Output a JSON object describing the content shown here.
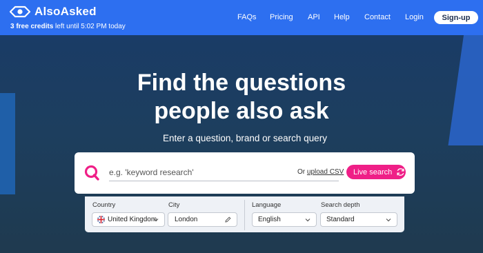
{
  "header": {
    "logo_text": "AlsoAsked",
    "credits_strong": "3 free credits",
    "credits_rest": " left until 5:02 PM today",
    "nav": [
      "FAQs",
      "Pricing",
      "API",
      "Help",
      "Contact",
      "Login"
    ],
    "signup_label": "Sign-up"
  },
  "hero": {
    "headline_line1": "Find the questions",
    "headline_line2": "people also ask",
    "subheadline": "Enter a question, brand or search query"
  },
  "search": {
    "placeholder": "e.g. 'keyword research'",
    "or_text": "Or ",
    "upload_link": "upload CSV",
    "live_search_label": "Live search"
  },
  "options": {
    "country": {
      "label": "Country",
      "value": "United Kingdom"
    },
    "city": {
      "label": "City",
      "value": "London"
    },
    "language": {
      "label": "Language",
      "value": "English"
    },
    "search_depth": {
      "label": "Search depth",
      "value": "Standard"
    }
  },
  "colors": {
    "header_bg": "#2d6ff0",
    "accent_pink": "#ef1f87",
    "hero_bg": "#1d3e5e"
  }
}
